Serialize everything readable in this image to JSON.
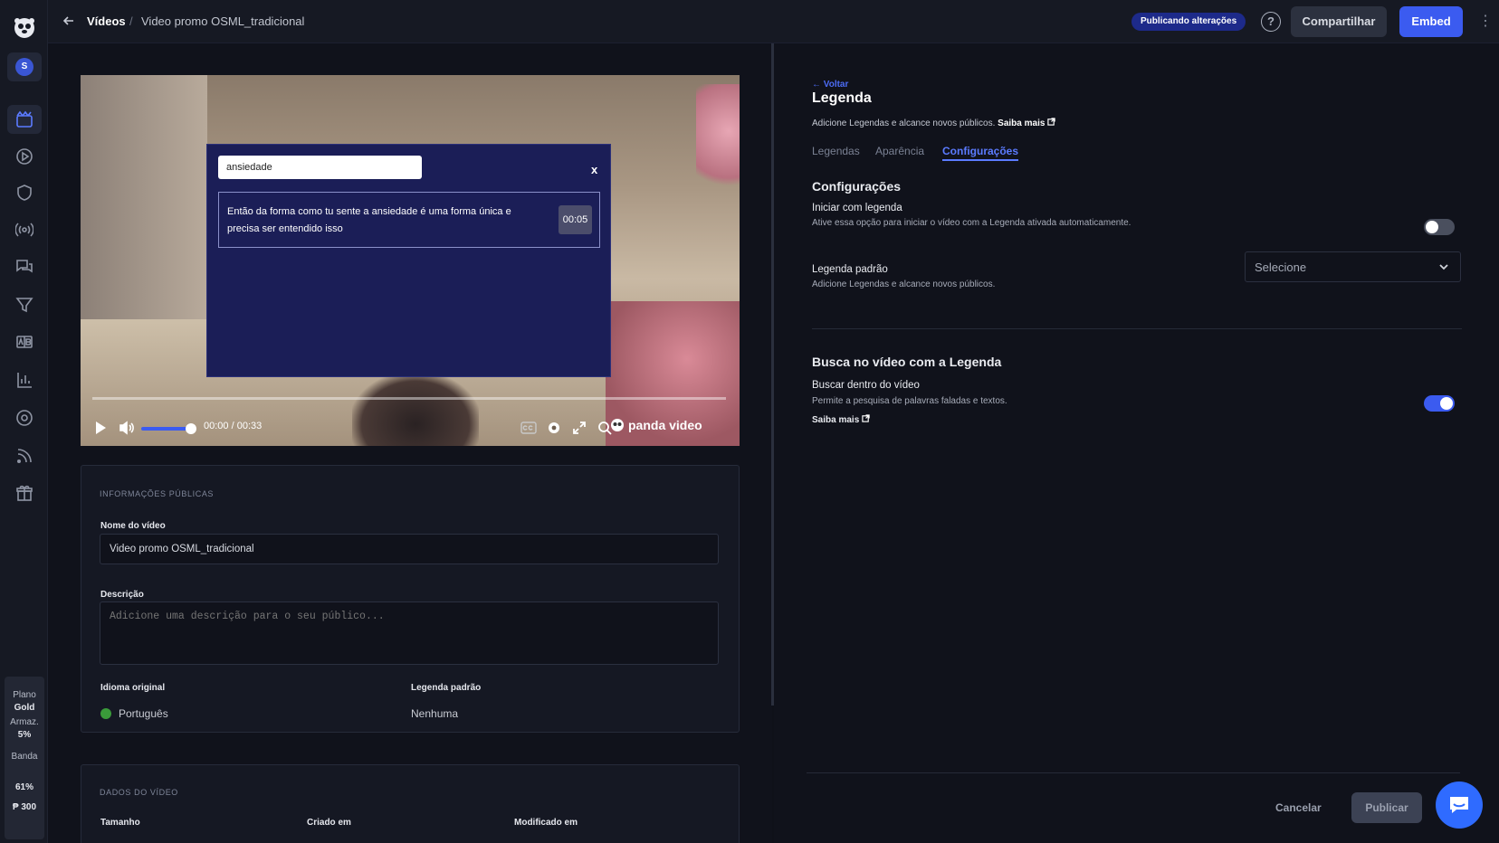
{
  "header": {
    "breadcrumb_root": "Vídeos",
    "breadcrumb_sep": "/",
    "breadcrumb_current": "Video promo OSML_tradicional",
    "status_badge": "Publicando alterações",
    "help": "?",
    "share_label": "Compartilhar",
    "embed_label": "Embed"
  },
  "sidebar": {
    "avatar_initial": "S",
    "icons": [
      "videos-icon",
      "play-icon",
      "shield-icon",
      "live-icon",
      "comments-icon",
      "funnel-icon",
      "ab-test-icon",
      "analytics-icon",
      "settings-icon",
      "rss-icon",
      "gift-icon"
    ],
    "plan": {
      "plan_label": "Plano",
      "plan_name": "Gold",
      "storage_label": "Armaz.",
      "storage_value": "5%",
      "bandwidth_label": "Banda",
      "bandwidth_value": "61%",
      "credits": "₱ 300"
    }
  },
  "player": {
    "search_query": "ansiedade",
    "close_label": "x",
    "result_text": "Então da forma como tu sente a ansiedade é uma forma única e precisa ser entendido isso",
    "result_time": "00:05",
    "current_time": "00:00",
    "time_sep": "/",
    "duration": "00:33",
    "volume_level": 0.8,
    "progress": 0,
    "brand": "panda video"
  },
  "public_info": {
    "section_title": "INFORMAÇÕES PÚBLICAS",
    "name_label": "Nome do vídeo",
    "name_value": "Video promo OSML_tradicional",
    "description_label": "Descrição",
    "description_placeholder": "Adicione uma descrição para o seu público...",
    "language_label": "Idioma original",
    "language_value": "Português",
    "default_sub_label": "Legenda padrão",
    "default_sub_value": "Nenhuma"
  },
  "video_data": {
    "section_title": "DADOS DO VÍDEO",
    "size_label": "Tamanho",
    "created_label": "Criado em",
    "modified_label": "Modificado em"
  },
  "panel": {
    "back_label": "← Voltar",
    "title": "Legenda",
    "subtitle": "Adicione Legendas e alcance novos públicos.",
    "learn_more": "Saiba mais",
    "tabs": [
      {
        "label": "Legendas"
      },
      {
        "label": "Aparência"
      },
      {
        "label": "Configurações"
      }
    ],
    "settings_title": "Configurações",
    "start_with_sub_title": "Iniciar com legenda",
    "start_with_sub_desc": "Ative essa opção para iniciar o vídeo com a Legenda ativada automaticamente.",
    "start_with_sub_enabled": false,
    "default_sub_title": "Legenda padrão",
    "default_sub_desc": "Adicione Legendas e alcance novos públicos.",
    "default_sub_select": "Selecione",
    "search_title": "Busca no vídeo com a Legenda",
    "search_opt_title": "Buscar dentro do vídeo",
    "search_opt_desc": "Permite a pesquisa de palavras faladas e textos.",
    "search_opt_enabled": true,
    "search_learn_more": "Saiba mais",
    "cancel_label": "Cancelar",
    "publish_label": "Publicar"
  },
  "colors": {
    "accent": "#3b5bf0",
    "link": "#5b7bff",
    "background": "#10121b"
  }
}
